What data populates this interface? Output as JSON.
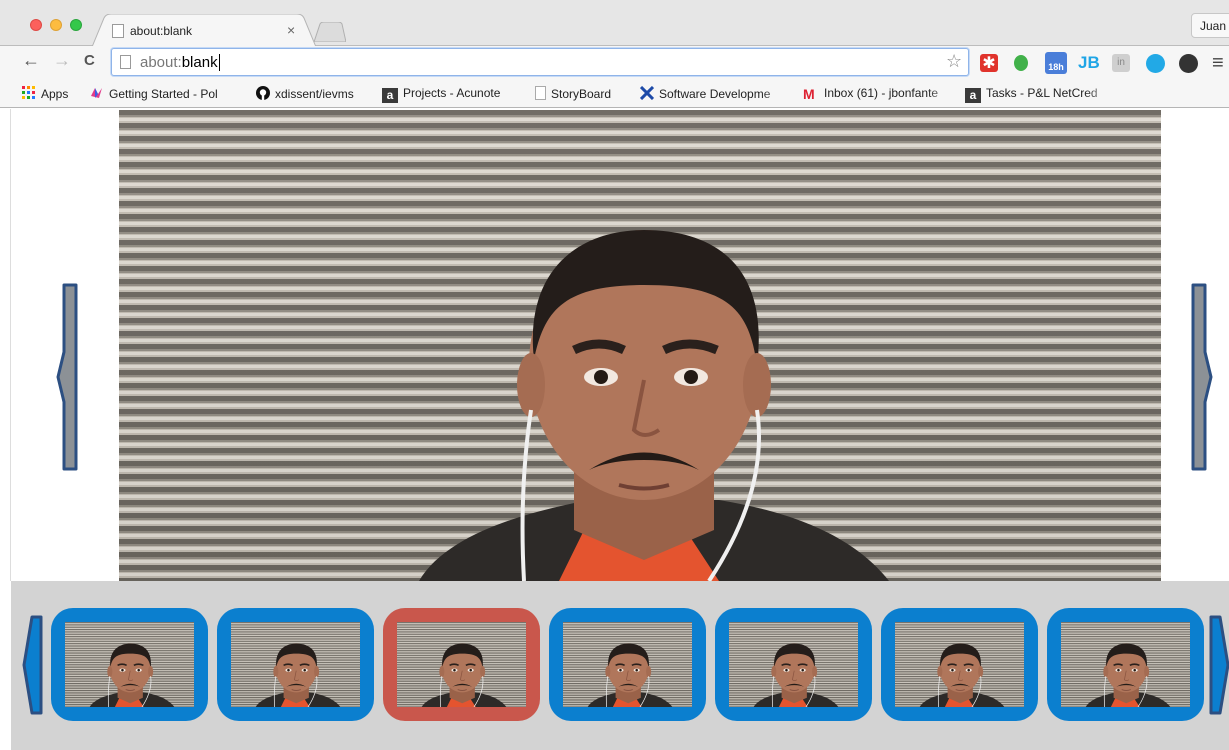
{
  "browser": {
    "tab_title": "about:blank",
    "tab_close": "×",
    "profile_name": "Juan",
    "address": {
      "scheme": "about:",
      "rest": "blank"
    },
    "calendar_badge": "18h",
    "jb_label": "JB",
    "in_label": "in",
    "asterisk": "✱",
    "menu": "≡",
    "back": "←",
    "forward": "→",
    "reload": "C",
    "star": "☆"
  },
  "bookmarks": [
    {
      "label": "Apps"
    },
    {
      "label": "Getting Started - Pol"
    },
    {
      "label": "xdissent/ievms"
    },
    {
      "label": "Projects - Acunote"
    },
    {
      "label": "StoryBoard"
    },
    {
      "label": "Software Developme"
    },
    {
      "label": "Inbox (61) - jbonfante"
    },
    {
      "label": "Tasks - P&L NetCred"
    }
  ],
  "carousel": {
    "selected_index": 2,
    "thumbnail_count": 7,
    "colors": {
      "frame": "#0b7fcf",
      "selected_frame": "#c9574c",
      "arrow_fill": "#8c9196",
      "arrow_stroke": "#2c4f82",
      "strip_bg": "#d3d3d3"
    }
  }
}
